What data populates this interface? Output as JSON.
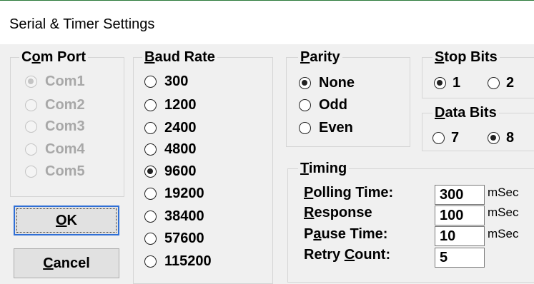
{
  "window": {
    "title": "Serial & Timer Settings"
  },
  "com_port": {
    "legend_pre": "C",
    "legend_ul": "o",
    "legend_post": "m Port",
    "options": [
      "Com1",
      "Com2",
      "Com3",
      "Com4",
      "Com5"
    ],
    "selected": "Com1",
    "enabled": false
  },
  "buttons": {
    "ok_ul": "O",
    "ok_post": "K",
    "cancel_ul": "C",
    "cancel_post": "ancel"
  },
  "baud_rate": {
    "legend_ul": "B",
    "legend_post": "aud Rate",
    "options": [
      "300",
      "1200",
      "2400",
      "4800",
      "9600",
      "19200",
      "38400",
      "57600",
      "115200"
    ],
    "selected": "9600"
  },
  "parity": {
    "legend_ul": "P",
    "legend_post": "arity",
    "options": [
      "None",
      "Odd",
      "Even"
    ],
    "selected": "None"
  },
  "stop_bits": {
    "legend_ul": "S",
    "legend_post": "top Bits",
    "options": [
      "1",
      "2"
    ],
    "selected": "1"
  },
  "data_bits": {
    "legend_ul": "D",
    "legend_post": "ata Bits",
    "options": [
      "7",
      "8"
    ],
    "selected": "8"
  },
  "timing": {
    "legend_ul": "T",
    "legend_post": "iming",
    "polling": {
      "ul": "P",
      "post": "olling Time:",
      "value": "300",
      "unit": "mSec"
    },
    "response": {
      "ul": "R",
      "post": "esponse",
      "value": "100",
      "unit": "mSec"
    },
    "pause": {
      "pre": "P",
      "ul": "a",
      "post": "use Time:",
      "value": "10",
      "unit": "mSec"
    },
    "retry": {
      "pre": "Retry ",
      "ul": "C",
      "post": "ount:",
      "value": "5"
    }
  }
}
